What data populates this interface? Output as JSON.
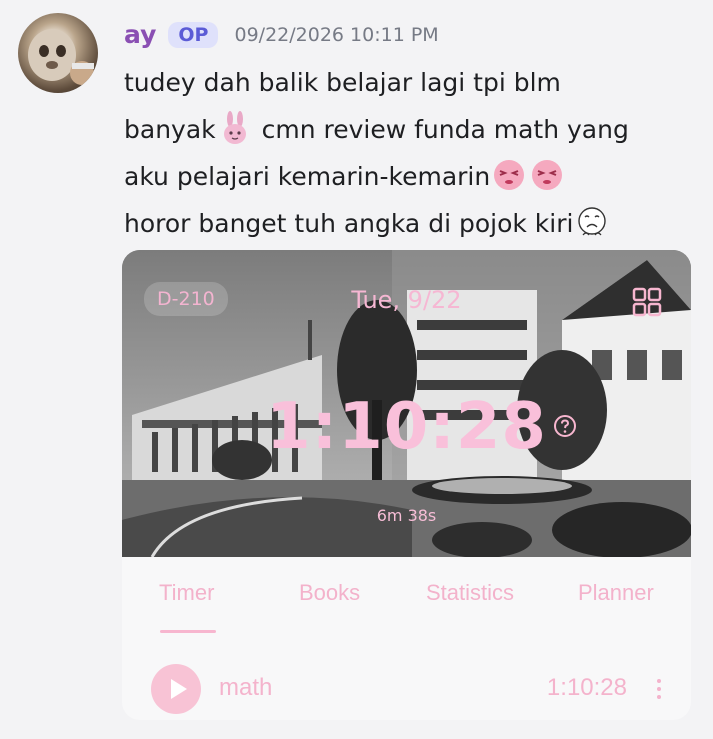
{
  "post": {
    "username": "ay",
    "badge": "OP",
    "timestamp": "09/22/2026 10:11 PM",
    "lines": [
      "tudey dah balik belajar lagi tpi blm",
      "banyak",
      "cmn review funda math yang",
      "aku pelajari kemarin-kemarin",
      "horor banget tuh angka di pojok kiri"
    ],
    "emojis": [
      "bunny-sticker-icon",
      "embarrassed-face-icon",
      "embarrassed-face-icon",
      "crying-face-icon"
    ]
  },
  "widget": {
    "countdown": "D-210",
    "date": "Tue, 9/22",
    "timer": "1:10:28",
    "session": "6m 38s",
    "tabs": [
      "Timer",
      "Books",
      "Statistics",
      "Planner"
    ],
    "active_tab": "Timer",
    "task_name": "math",
    "task_time": "1:10:28",
    "accent_color": "#f7b6cf"
  }
}
